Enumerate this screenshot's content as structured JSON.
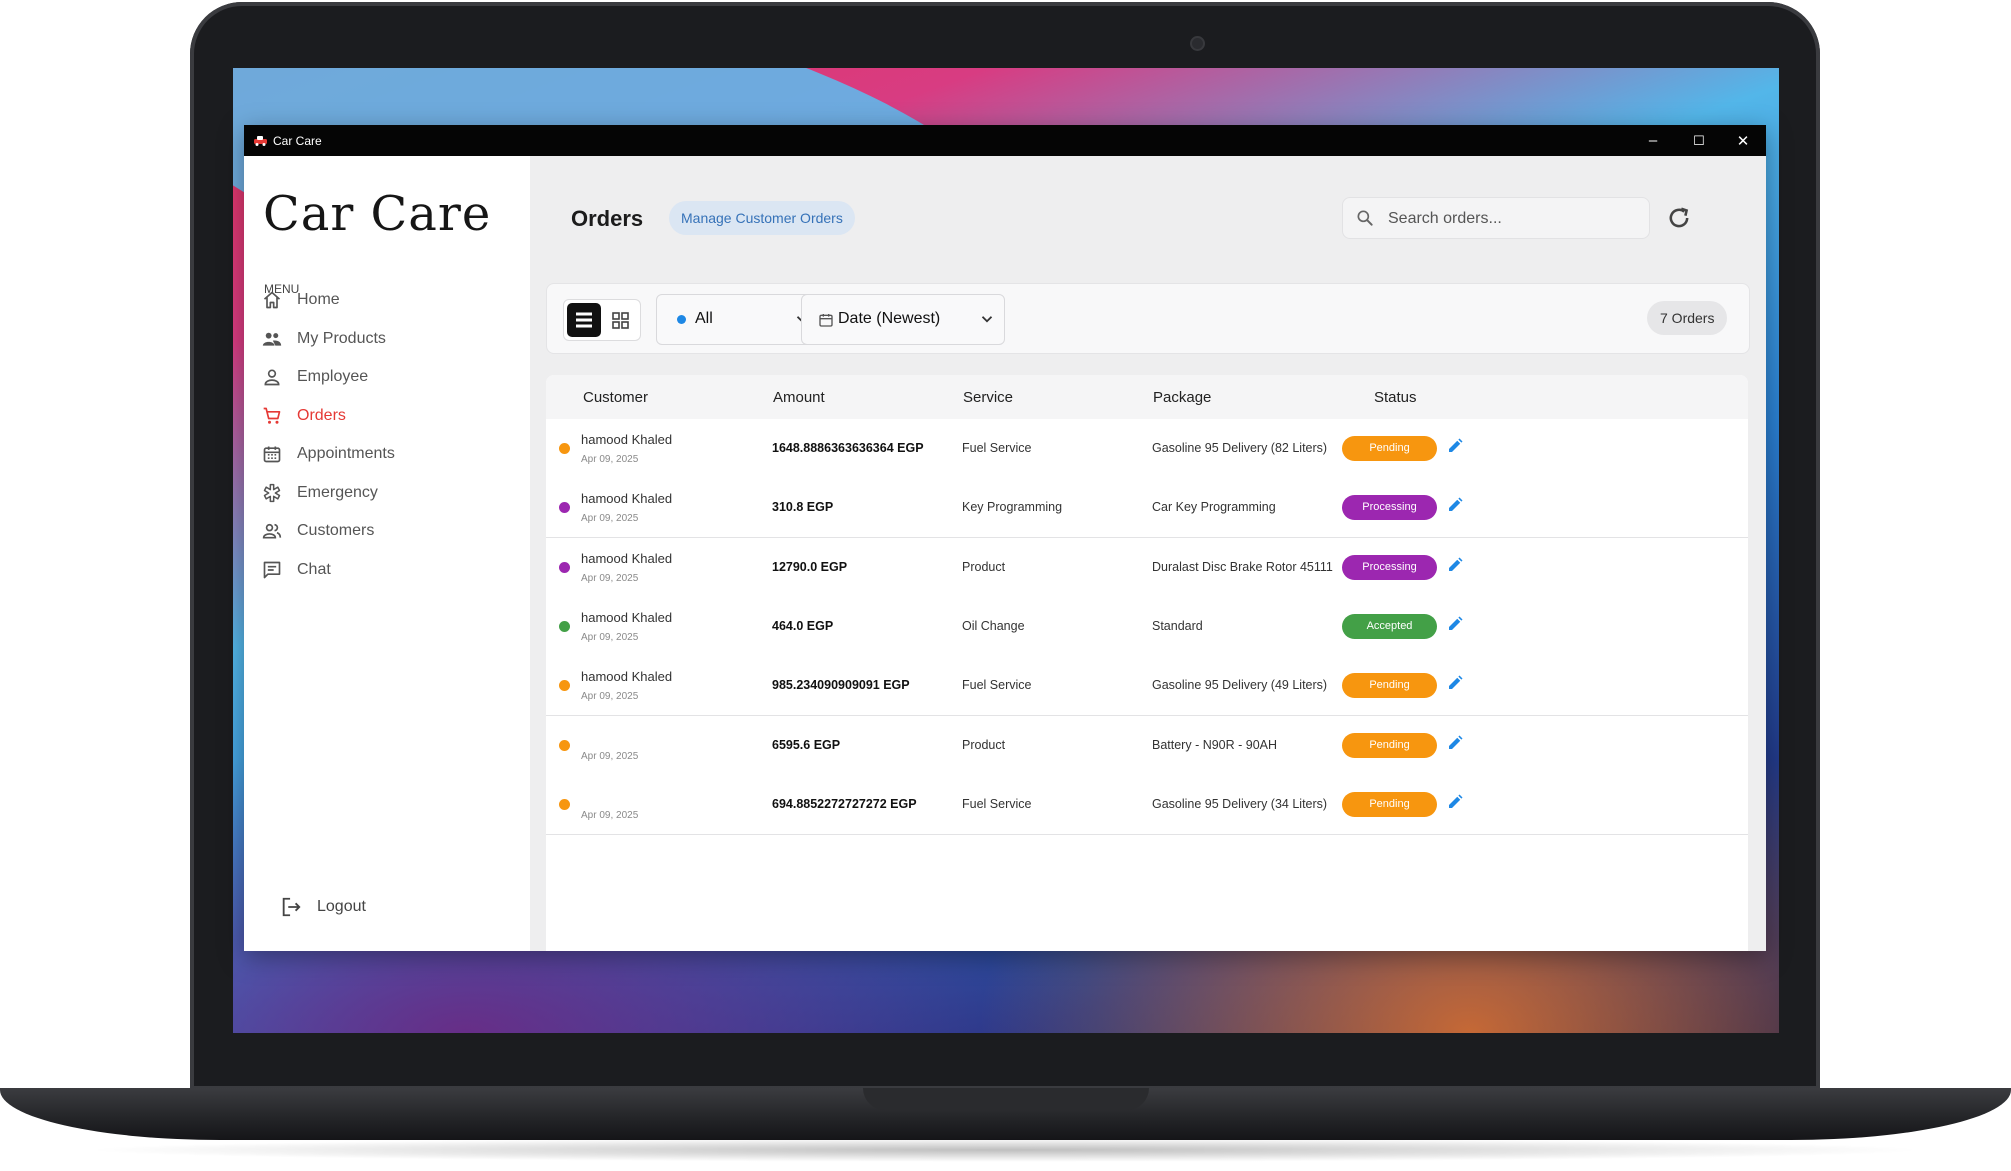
{
  "window": {
    "title": "Car Care",
    "minimize": "–",
    "maximize": "☐",
    "close": "✕"
  },
  "sidebar": {
    "brand": "Car Care",
    "menu_caption": "MENU",
    "items": [
      {
        "label": "Home",
        "icon": "home-icon"
      },
      {
        "label": "My Products",
        "icon": "people-icon"
      },
      {
        "label": "Employee",
        "icon": "person-icon"
      },
      {
        "label": "Orders",
        "icon": "cart-icon",
        "active": true
      },
      {
        "label": "Appointments",
        "icon": "calendar-icon"
      },
      {
        "label": "Emergency",
        "icon": "emergency-icon"
      },
      {
        "label": "Customers",
        "icon": "customers-icon"
      },
      {
        "label": "Chat",
        "icon": "chat-icon"
      }
    ],
    "logout": "Logout"
  },
  "header": {
    "title": "Orders",
    "chip": "Manage Customer Orders",
    "search_placeholder": "Search orders...",
    "refresh_icon": "refresh-icon"
  },
  "toolbar": {
    "status_filter": "All",
    "sort": "Date (Newest)",
    "count": "7 Orders"
  },
  "colors": {
    "accent": "#e53935",
    "pending": "#f7960f",
    "processing": "#9c27b0",
    "accepted": "#43a047",
    "edit": "#1e88e5"
  },
  "table": {
    "columns": [
      "Customer",
      "Amount",
      "Service",
      "Package",
      "Status"
    ],
    "rows": [
      {
        "customer": "hamood Khaled",
        "date": "Apr 09, 2025",
        "amount": "1648.8886363636364 EGP",
        "service": "Fuel Service",
        "package": "Gasoline 95 Delivery (82 Liters)",
        "status": "Pending",
        "color": "#f7960f"
      },
      {
        "customer": "hamood Khaled",
        "date": "Apr 09, 2025",
        "amount": "310.8 EGP",
        "service": "Key Programming",
        "package": "Car Key Programming",
        "status": "Processing",
        "color": "#9c27b0"
      },
      {
        "customer": "hamood Khaled",
        "date": "Apr 09, 2025",
        "amount": "12790.0 EGP",
        "service": "Product",
        "package": "Duralast Disc Brake Rotor 45111",
        "status": "Processing",
        "color": "#9c27b0"
      },
      {
        "customer": "hamood Khaled",
        "date": "Apr 09, 2025",
        "amount": "464.0 EGP",
        "service": "Oil Change",
        "package": "Standard",
        "status": "Accepted",
        "color": "#43a047"
      },
      {
        "customer": "hamood Khaled",
        "date": "Apr 09, 2025",
        "amount": "985.234090909091 EGP",
        "service": "Fuel Service",
        "package": "Gasoline 95 Delivery (49 Liters)",
        "status": "Pending",
        "color": "#f7960f"
      },
      {
        "customer": "",
        "date": "Apr 09, 2025",
        "amount": "6595.6 EGP",
        "service": "Product",
        "package": "Battery - N90R - 90AH",
        "status": "Pending",
        "color": "#f7960f"
      },
      {
        "customer": "",
        "date": "Apr 09, 2025",
        "amount": "694.8852272727272 EGP",
        "service": "Fuel Service",
        "package": "Gasoline 95 Delivery (34 Liters)",
        "status": "Pending",
        "color": "#f7960f"
      }
    ]
  }
}
